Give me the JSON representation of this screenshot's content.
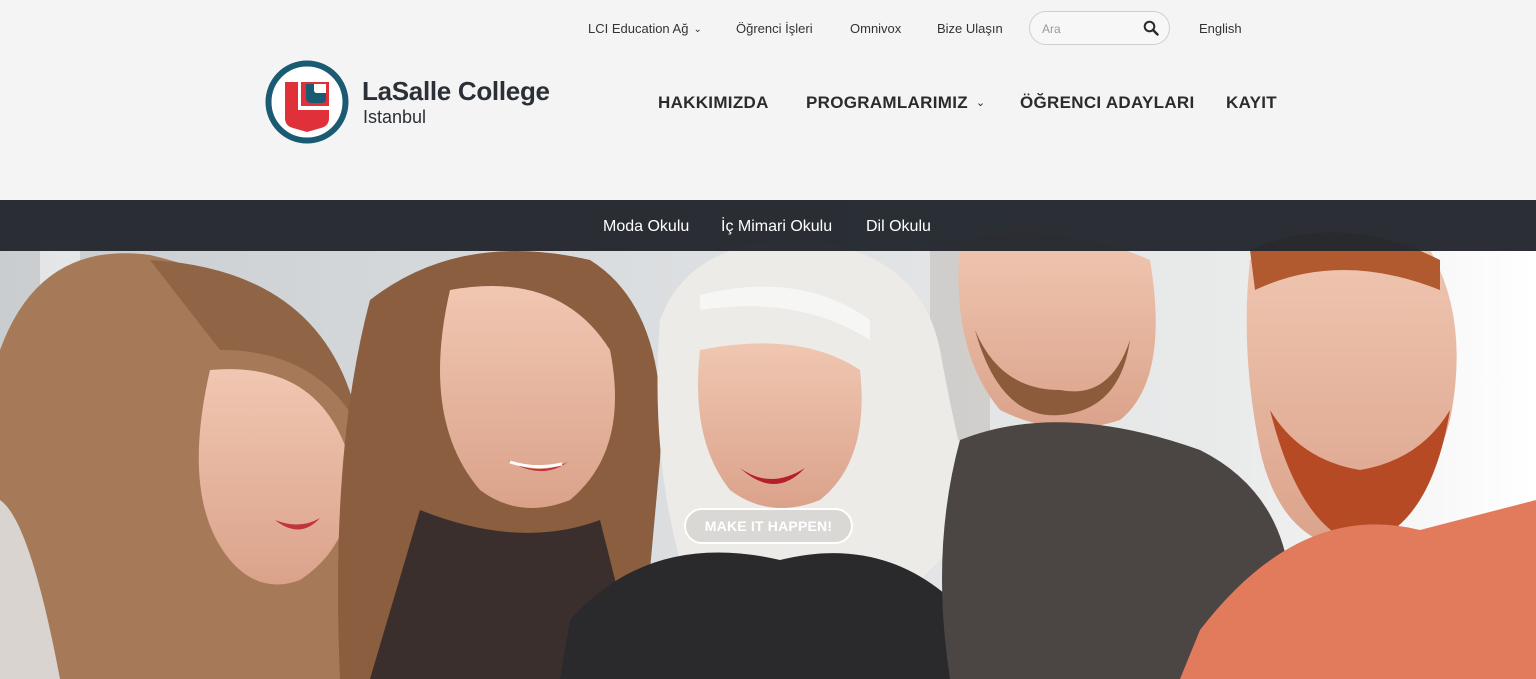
{
  "utility_nav": {
    "network_label": "LCI Education Ağ",
    "student_affairs": "Öğrenci İşleri",
    "omnivox": "Omnivox",
    "contact": "Bize Ulaşın",
    "search_placeholder": "Ara",
    "language": "English"
  },
  "brand": {
    "name": "LaSalle College",
    "city": "Istanbul",
    "colors": {
      "ring": "#1a5a73",
      "shield": "#e0303a",
      "text": "#2b3036"
    }
  },
  "main_nav": {
    "about": "HAKKIMIZDA",
    "programs": "PROGRAMLARIMIZ",
    "prospective": "ÖĞRENCI ADAYLARI",
    "enroll": "KAYIT"
  },
  "school_nav": {
    "fashion": "Moda Okulu",
    "interior": "İç Mimari Okulu",
    "language": "Dil Okulu"
  },
  "hero": {
    "cta_label": "MAKE IT HAPPEN!"
  },
  "icons": {
    "network_dropdown": "chevron-down-icon",
    "programs_dropdown": "chevron-down-icon",
    "search": "search-icon"
  }
}
